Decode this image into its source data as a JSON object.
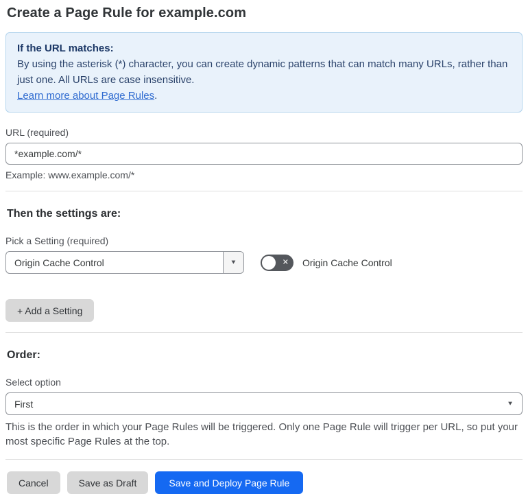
{
  "page": {
    "title": "Create a Page Rule for example.com"
  },
  "info_box": {
    "heading": "If the URL matches:",
    "body": "By using the asterisk (*) character, you can create dynamic patterns that can match many URLs, rather than just one. All URLs are case insensitive.",
    "link_label": "Learn more about Page Rules",
    "link_suffix": "."
  },
  "url_field": {
    "label": "URL (required)",
    "value": "*example.com/*",
    "helper": "Example: www.example.com/*"
  },
  "settings_section": {
    "heading": "Then the settings are:",
    "picker_label": "Pick a Setting (required)",
    "picker_value": "Origin Cache Control",
    "toggle_label": "Origin Cache Control",
    "toggle_state": "off",
    "add_setting_button": "+ Add a Setting"
  },
  "order_section": {
    "heading": "Order:",
    "select_label": "Select option",
    "select_value": "First",
    "helper": "This is the order in which your Page Rules will be triggered. Only one Page Rule will trigger per URL, so put your most specific Page Rules at the top."
  },
  "footer": {
    "cancel_label": "Cancel",
    "save_draft_label": "Save as Draft",
    "save_deploy_label": "Save and Deploy Page Rule"
  },
  "icons": {
    "dropdown_arrow": "▼",
    "toggle_off": "✕"
  },
  "colors": {
    "accent_blue": "#1569f2",
    "info_background": "#e9f2fb",
    "info_border": "#b3d4ed",
    "info_text": "#2b436b",
    "link_blue": "#2f6bd0",
    "toggle_off_background": "#54575c",
    "gray_button_background": "#d8d8d8"
  }
}
